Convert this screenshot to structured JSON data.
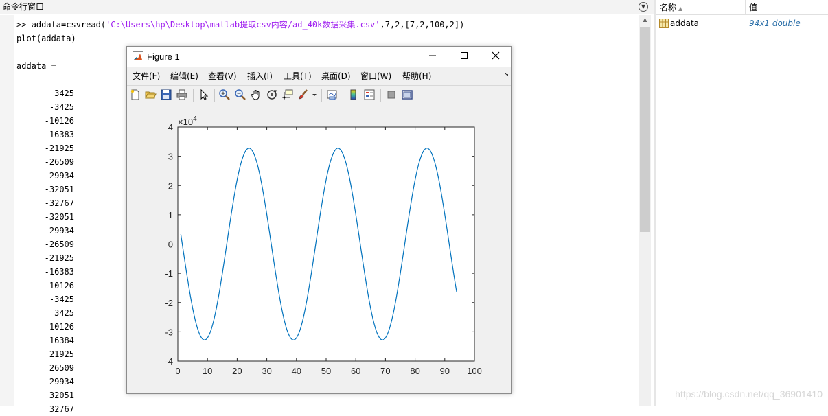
{
  "command_window": {
    "title": "命令行窗口",
    "command_prompt": ">>",
    "command_1_prefix": "addata=csvread(",
    "command_1_string": "'C:\\Users\\hp\\Desktop\\matlab提取csv内容/ad_40k数据采集.csv'",
    "command_1_suffix": ",7,2,[7,2,100,2])",
    "command_2": "plot(addata)",
    "output_header": "addata =",
    "output_values": [
      "3425",
      "-3425",
      "-10126",
      "-16383",
      "-21925",
      "-26509",
      "-29934",
      "-32051",
      "-32767",
      "-32051",
      "-29934",
      "-26509",
      "-21925",
      "-16383",
      "-10126",
      "-3425",
      "3425",
      "10126",
      "16384",
      "21925",
      "26509",
      "29934",
      "32051",
      "32767"
    ]
  },
  "workspace": {
    "col_name": "名称",
    "col_value": "值",
    "variable_name": "addata",
    "variable_value": "94x1 double"
  },
  "figure": {
    "title": "Figure 1",
    "menus": [
      "文件(F)",
      "编辑(E)",
      "查看(V)",
      "插入(I)",
      "工具(T)",
      "桌面(D)",
      "窗口(W)",
      "帮助(H)"
    ],
    "toolbar_icons": [
      "new-figure-icon",
      "open-file-icon",
      "save-icon",
      "print-icon",
      "pointer-icon",
      "zoom-in-icon",
      "zoom-out-icon",
      "pan-icon",
      "rotate-3d-icon",
      "data-cursor-icon",
      "brush-icon",
      "link-plot-icon",
      "colorbar-icon",
      "legend-icon",
      "hide-plot-tools-icon",
      "show-plot-tools-icon"
    ]
  },
  "chart_data": {
    "type": "line",
    "exponent_label": "×10",
    "exponent_power": "4",
    "xlim": [
      0,
      100
    ],
    "ylim": [
      -4,
      4
    ],
    "y_scale": 10000,
    "x_ticks": [
      0,
      10,
      20,
      30,
      40,
      50,
      60,
      70,
      80,
      90,
      100
    ],
    "y_ticks": [
      -4,
      -3,
      -2,
      -1,
      0,
      1,
      2,
      3,
      4
    ],
    "line_color": "#0072bd",
    "series": [
      {
        "x": [
          1,
          2,
          3,
          4,
          5,
          6,
          7,
          8,
          9,
          10,
          11,
          12,
          13,
          14,
          15,
          16,
          17,
          18,
          19,
          20,
          21,
          22,
          23,
          24,
          25,
          26,
          27,
          28,
          29,
          30,
          31,
          32,
          33,
          34,
          35,
          36,
          37,
          38,
          39,
          40,
          41,
          42,
          43,
          44,
          45,
          46,
          47,
          48,
          49,
          50,
          51,
          52,
          53,
          54,
          55,
          56,
          57,
          58,
          59,
          60,
          61,
          62,
          63,
          64,
          65,
          66,
          67,
          68,
          69,
          70,
          71,
          72,
          73,
          74,
          75,
          76,
          77,
          78,
          79,
          80,
          81,
          82,
          83,
          84,
          85,
          86,
          87,
          88,
          89,
          90,
          91,
          92,
          93,
          94
        ],
        "y": [
          3425,
          -3425,
          -10126,
          -16383,
          -21925,
          -26509,
          -29934,
          -32051,
          -32767,
          -32051,
          -29934,
          -26509,
          -21925,
          -16383,
          -10126,
          -3425,
          3425,
          10126,
          16384,
          21925,
          26509,
          29934,
          32051,
          32767,
          32051,
          29934,
          26509,
          21925,
          16383,
          10126,
          3425,
          -3425,
          -10126,
          -16383,
          -21925,
          -26509,
          -29934,
          -32051,
          -32767,
          -32051,
          -29934,
          -26509,
          -21925,
          -16383,
          -10126,
          -3425,
          3425,
          10126,
          16384,
          21925,
          26509,
          29934,
          32051,
          32767,
          32051,
          29934,
          26509,
          21925,
          16383,
          10126,
          3425,
          -3425,
          -10126,
          -16383,
          -21925,
          -26509,
          -29934,
          -32051,
          -32767,
          -32051,
          -29934,
          -26509,
          -21925,
          -16383,
          -10126,
          -3425,
          3425,
          10126,
          16384,
          21925,
          26509,
          29934,
          32051,
          32767,
          32051,
          29934,
          26509,
          21925,
          16383,
          10126,
          3425,
          -3425,
          -10126,
          -16383
        ]
      }
    ]
  },
  "watermark": "https://blog.csdn.net/qq_36901410"
}
